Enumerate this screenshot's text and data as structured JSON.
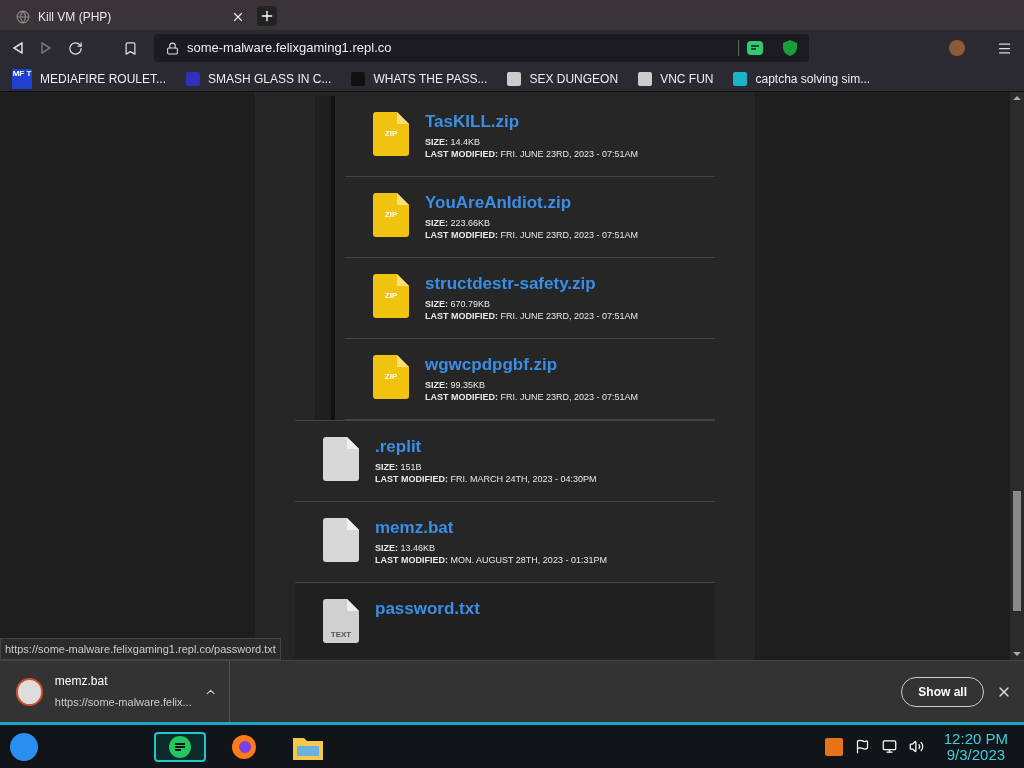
{
  "browser": {
    "tab": {
      "title": "Kill VM (PHP)"
    },
    "address": "some-malware.felixgaming1.repl.co",
    "bookmarks": [
      {
        "label": "MEDIAFIRE ROULET...",
        "icon_text": "MF T"
      },
      {
        "label": "SMASH GLASS IN C..."
      },
      {
        "label": "WHATS THE PASS..."
      },
      {
        "label": "SEX DUNGEON"
      },
      {
        "label": "VNC FUN"
      },
      {
        "label": "captcha solving sim..."
      }
    ]
  },
  "folder": {
    "children": [
      {
        "kind": "zip",
        "icon_text": "ZIP",
        "name": "TasKILL.zip",
        "size_label": "SIZE:",
        "size": "14.4KB",
        "modified_label": "LAST MODIFIED:",
        "modified": "FRI. JUNE 23RD, 2023 - 07:51AM"
      },
      {
        "kind": "zip",
        "icon_text": "ZIP",
        "name": "YouAreAnIdiot.zip",
        "size_label": "SIZE:",
        "size": "223.66KB",
        "modified_label": "LAST MODIFIED:",
        "modified": "FRI. JUNE 23RD, 2023 - 07:51AM"
      },
      {
        "kind": "zip",
        "icon_text": "ZIP",
        "name": "structdestr-safety.zip",
        "size_label": "SIZE:",
        "size": "670.79KB",
        "modified_label": "LAST MODIFIED:",
        "modified": "FRI. JUNE 23RD, 2023 - 07:51AM"
      },
      {
        "kind": "zip",
        "icon_text": "ZIP",
        "name": "wgwcpdpgbf.zip",
        "size_label": "SIZE:",
        "size": "99.35KB",
        "modified_label": "LAST MODIFIED:",
        "modified": "FRI. JUNE 23RD, 2023 - 07:51AM"
      }
    ]
  },
  "files": [
    {
      "kind": "file",
      "name": ".replit",
      "size_label": "SIZE:",
      "size": "151B",
      "modified_label": "LAST MODIFIED:",
      "modified": "FRI. MARCH 24TH, 2023 - 04:30PM"
    },
    {
      "kind": "file",
      "name": "memz.bat",
      "size_label": "SIZE:",
      "size": "13.46KB",
      "modified_label": "LAST MODIFIED:",
      "modified": "MON. AUGUST 28TH, 2023 - 01:31PM"
    },
    {
      "kind": "text",
      "icon_text": "TEXT",
      "name": "password.txt"
    }
  ],
  "status_url": "https://some-malware.felixgaming1.repl.co/password.txt",
  "downloads": {
    "items": [
      {
        "name": "memz.bat",
        "url": "https://some-malware.felix..."
      }
    ],
    "show_all": "Show all"
  },
  "taskbar": {
    "time": "12:20 PM",
    "date": "9/3/2023"
  }
}
